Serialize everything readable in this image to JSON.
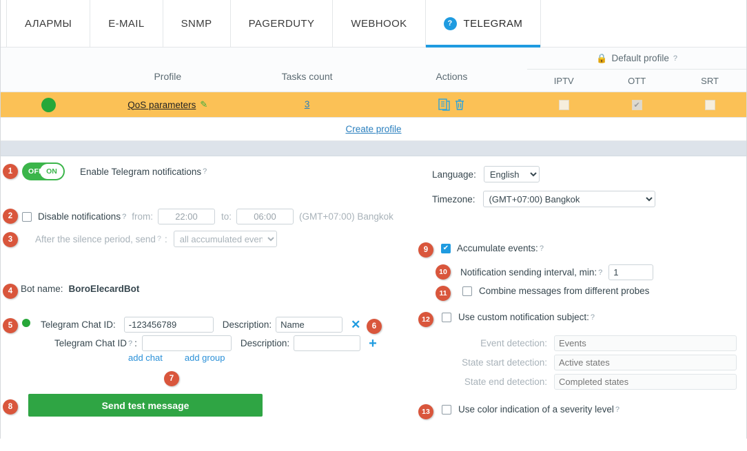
{
  "tabs": [
    {
      "label": "АЛАРМЫ",
      "active": false,
      "icon": null
    },
    {
      "label": "E-MAIL",
      "active": false,
      "icon": null
    },
    {
      "label": "SNMP",
      "active": false,
      "icon": null
    },
    {
      "label": "PAGERDUTY",
      "active": false,
      "icon": null
    },
    {
      "label": "WEBHOOK",
      "active": false,
      "icon": null
    },
    {
      "label": "TELEGRAM",
      "active": true,
      "icon": "help-circle-icon"
    }
  ],
  "table": {
    "headers": {
      "profile": "Profile",
      "tasks_count": "Tasks count",
      "actions": "Actions",
      "default_profile": "Default profile",
      "default_profile_lock_icon": "lock-icon",
      "flag_columns": [
        "IPTV",
        "OTT",
        "SRT"
      ]
    },
    "row": {
      "status_icon": "green-status-dot",
      "profile_name": "QoS parameters",
      "edit_icon": "pencil-icon",
      "tasks_count": "3",
      "actions": [
        "copy-icon",
        "trash-icon"
      ],
      "flags": [
        {
          "name": "IPTV",
          "checked": false
        },
        {
          "name": "OTT",
          "checked": true
        },
        {
          "name": "SRT",
          "checked": false
        }
      ]
    },
    "create_profile_link": "Create profile"
  },
  "form": {
    "enable": {
      "badge": "1",
      "toggle_off": "OFF",
      "toggle_on": "ON",
      "label": "Enable Telegram notifications"
    },
    "disable_notifications": {
      "badge": "2",
      "label": "Disable notifications",
      "checked": false,
      "from_label": "from:",
      "from_value": "22:00",
      "to_label": "to:",
      "to_value": "06:00",
      "timezone_note": "(GMT+07:00) Bangkok"
    },
    "silence_period": {
      "badge": "3",
      "label": "After the silence period, send",
      "colon": ":",
      "select_value": "all accumulated events"
    },
    "bot": {
      "badge": "4",
      "label": "Bot name:",
      "value": "BoroElecardBot"
    },
    "chat_ids": {
      "badge": "5",
      "remove_badge": "6",
      "links_badge": "7",
      "status_icon": "green-status-dot",
      "rows": [
        {
          "label": "Telegram Chat ID:",
          "value": "-123456789",
          "description_label": "Description:",
          "description_value": "Name",
          "action_icon": "close-x-icon"
        },
        {
          "label": "Telegram Chat ID",
          "colon": ":",
          "value": "",
          "description_label": "Description:",
          "description_value": "",
          "action_icon": "plus-icon"
        }
      ],
      "add_chat_link": "add chat",
      "add_group_link": "add group"
    },
    "send_test": {
      "badge": "8",
      "label": "Send test message",
      "color": "#2fa544"
    },
    "language": {
      "label": "Language:",
      "value": "English"
    },
    "timezone": {
      "label": "Timezone:",
      "value": "(GMT+07:00) Bangkok"
    },
    "accumulate": {
      "badge": "9",
      "label": "Accumulate events:",
      "checked": true
    },
    "interval": {
      "badge": "10",
      "label": "Notification sending interval, min:",
      "value": "1"
    },
    "combine": {
      "badge": "11",
      "label": "Combine messages from different probes",
      "checked": false
    },
    "custom_subject": {
      "badge": "12",
      "label": "Use custom notification subject:",
      "checked": false,
      "fields": [
        {
          "label": "Event detection:",
          "placeholder": "Events"
        },
        {
          "label": "State start detection:",
          "placeholder": "Active states"
        },
        {
          "label": "State end detection:",
          "placeholder": "Completed states"
        }
      ]
    },
    "color_indication": {
      "badge": "13",
      "label": "Use color indication of a severity level",
      "checked": false
    }
  },
  "colors": {
    "accent_blue": "#1f9be0",
    "row_highlight": "#fbc156",
    "badge": "#d9563c",
    "green": "#2fa544"
  }
}
